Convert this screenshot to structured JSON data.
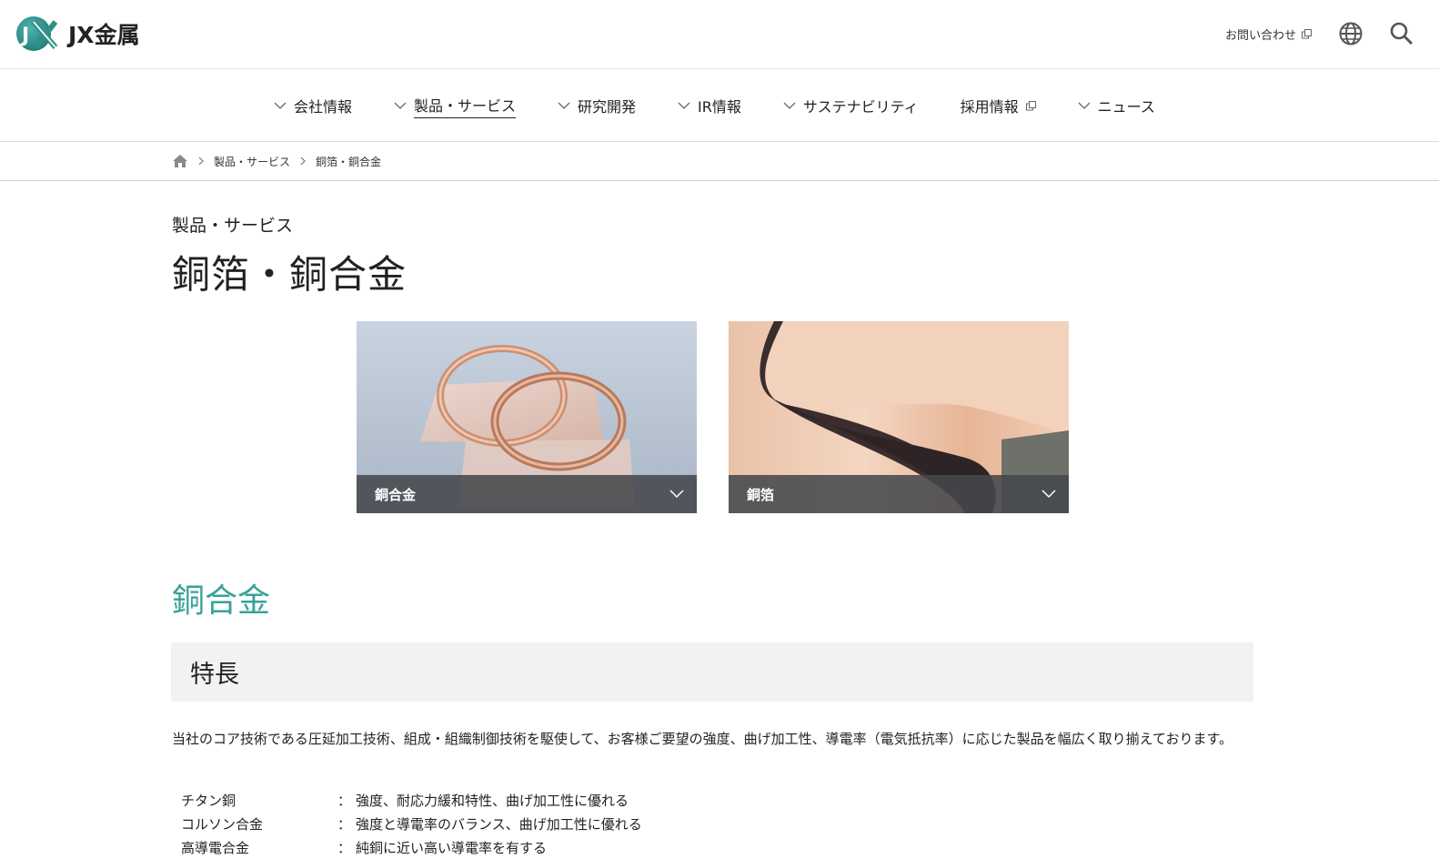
{
  "header": {
    "logo_text": "JX金属",
    "logo_mark": "JX",
    "contact_label": "お問い合わせ",
    "icons": [
      "external-link-icon",
      "globe-icon",
      "search-icon"
    ]
  },
  "nav": {
    "items": [
      {
        "label": "会社情報"
      },
      {
        "label": "製品・サービス",
        "active": true
      },
      {
        "label": "研究開発"
      },
      {
        "label": "IR情報"
      },
      {
        "label": "サステナビリティ"
      },
      {
        "label": "採用情報",
        "external": true
      },
      {
        "label": "ニュース"
      }
    ]
  },
  "breadcrumb": {
    "items": [
      "製品・サービス",
      "銅箔・銅合金"
    ]
  },
  "page": {
    "category": "製品・サービス",
    "title": "銅箔・銅合金"
  },
  "cards": [
    {
      "label": "銅合金"
    },
    {
      "label": "銅箔"
    }
  ],
  "section": {
    "title": "銅合金",
    "subheading": "特長",
    "intro": "当社のコア技術である圧延加工技術、組成・組織制御技術を駆使して、お客様ご要望の強度、曲げ加工性、導電率（電気抵抗率）に応じた製品を幅広く取り揃えております。",
    "features": [
      {
        "name": "チタン銅",
        "sep": "：",
        "desc": "強度、耐応力緩和特性、曲げ加工性に優れる"
      },
      {
        "name": "コルソン合金",
        "sep": "：",
        "desc": "強度と導電率のバランス、曲げ加工性に優れる"
      },
      {
        "name": "高導電合金",
        "sep": "：",
        "desc": "純銅に近い高い導電率を有する"
      }
    ]
  },
  "colors": {
    "accent": "#3aa19b",
    "logo_teal": "#2a8a86",
    "card_bar": "#46484c",
    "subheading_bg": "#f2f2f2"
  }
}
